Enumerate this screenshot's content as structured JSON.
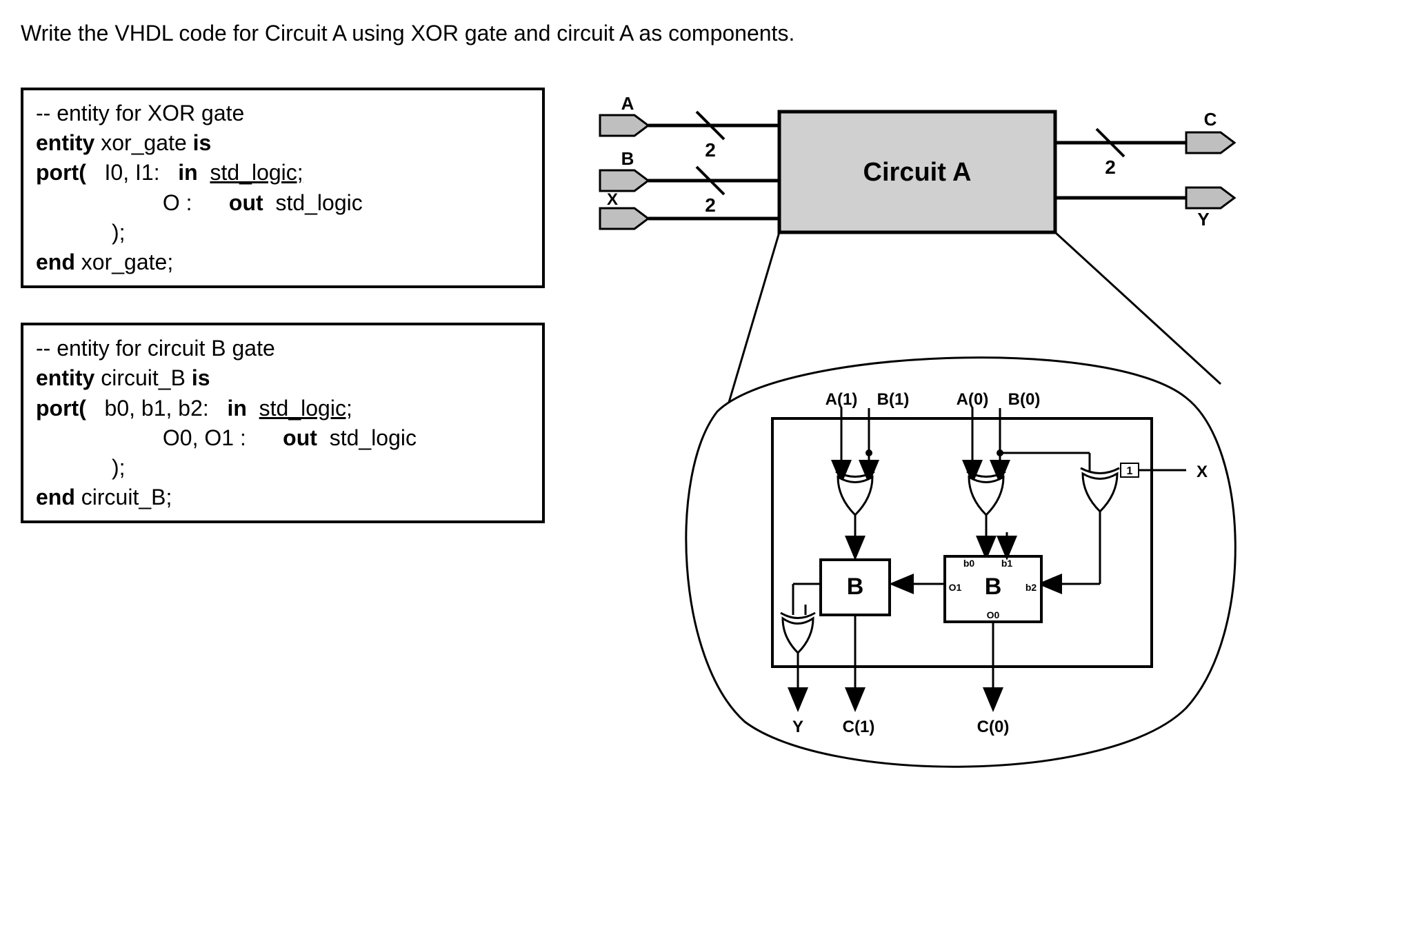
{
  "question": "Write the VHDL code for Circuit A using XOR gate and circuit A as components.",
  "xor_entity": {
    "comment": "-- entity for XOR gate",
    "kw_entity": "entity",
    "name": "xor_gate",
    "kw_is": "is",
    "kw_port": "port(",
    "inputs": "I0, I1:",
    "kw_in": "in",
    "in_type": "std_logic;",
    "output": "O :",
    "kw_out": "out",
    "out_type": "std_logic",
    "close": ");",
    "kw_end": "end",
    "end_name": "xor_gate;"
  },
  "circuitB_entity": {
    "comment": "-- entity for circuit B gate",
    "kw_entity": "entity",
    "name": "circuit_B",
    "kw_is": "is",
    "kw_port": "port(",
    "inputs": "b0, b1, b2:",
    "kw_in": "in",
    "in_type": "std_logic;",
    "output": "O0, O1 :",
    "kw_out": "out",
    "out_type": "std_logic",
    "close": ");",
    "kw_end": "end",
    "end_name": "circuit_B;"
  },
  "diagram": {
    "title": "Circuit A",
    "port_A": "A",
    "port_B": "B",
    "port_X": "X",
    "port_C": "C",
    "port_Y": "Y",
    "bus2_a": "2",
    "bus2_b": "2",
    "bus2_c": "2",
    "inner_A1": "A(1)",
    "inner_B1": "B(1)",
    "inner_A0": "A(0)",
    "inner_B0": "B(0)",
    "inner_X": "X",
    "inner_Y": "Y",
    "inner_C1": "C(1)",
    "inner_C0": "C(0)",
    "B_left": "B",
    "B_right": "B",
    "b0": "b0",
    "b1": "b1",
    "b2": "b2",
    "o0": "O0",
    "o1": "O1",
    "one": "1"
  }
}
